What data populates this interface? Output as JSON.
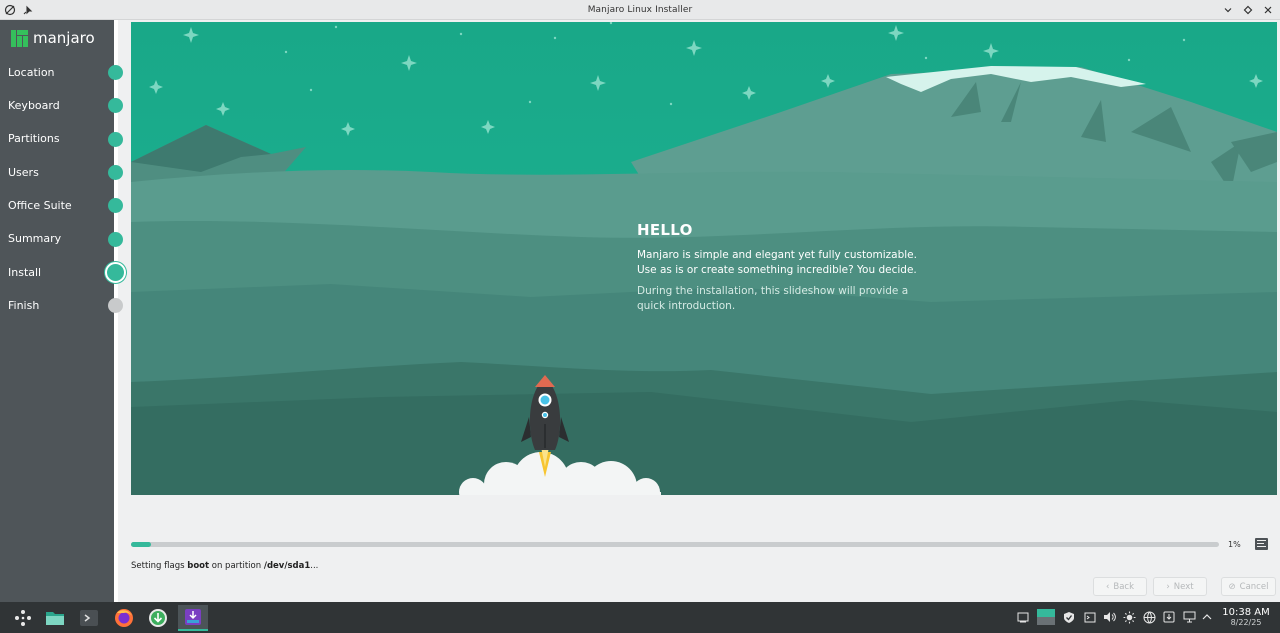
{
  "window": {
    "title": "Manjaro Linux Installer"
  },
  "sidebar": {
    "logo_text": "manjaro",
    "steps": [
      {
        "label": "Location",
        "state": "done"
      },
      {
        "label": "Keyboard",
        "state": "done"
      },
      {
        "label": "Partitions",
        "state": "done"
      },
      {
        "label": "Users",
        "state": "done"
      },
      {
        "label": "Office Suite",
        "state": "done"
      },
      {
        "label": "Summary",
        "state": "done"
      },
      {
        "label": "Install",
        "state": "current"
      },
      {
        "label": "Finish",
        "state": "pending"
      }
    ]
  },
  "slide": {
    "title": "HELLO",
    "body_line1": "Manjaro is simple and elegant yet fully customizable.",
    "body_line2": "Use as is or create something incredible? You decide.",
    "sub_line1": "During the installation, this slideshow will provide a",
    "sub_line2": "quick introduction."
  },
  "progress": {
    "percent_label": "1%",
    "value": 0.018
  },
  "status": {
    "prefix": "Setting flags ",
    "flag": "boot",
    "middle": " on partition ",
    "partition": "/dev/sda1",
    "suffix": "..."
  },
  "buttons": {
    "back": "Back",
    "next": "Next",
    "cancel": "Cancel"
  },
  "taskbar": {
    "time": "10:38 AM",
    "date": "8/22/25"
  },
  "colors": {
    "accent": "#35b99b",
    "sidebar_bg": "#4f5559",
    "taskbar_bg": "#303436"
  }
}
